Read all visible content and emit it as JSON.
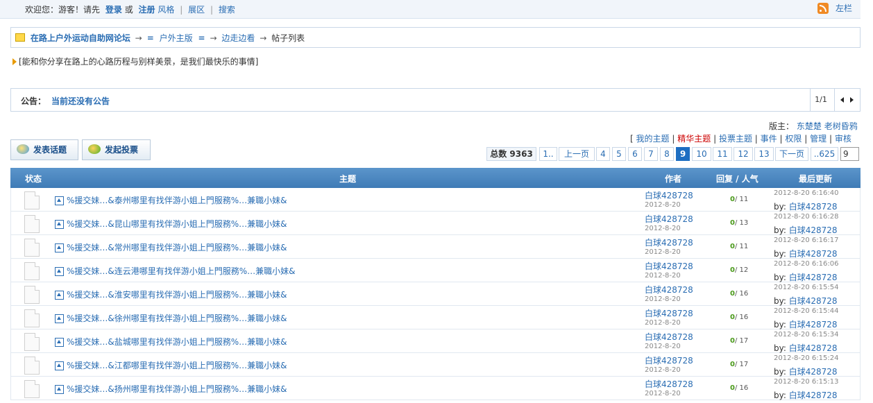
{
  "topbar": {
    "welcome": "欢迎您：游客！请先",
    "login": "登录",
    "or": "或",
    "register": "注册",
    "style": "风格",
    "exhibit": "展区",
    "search": "搜索",
    "sidebar": "左栏"
  },
  "breadcrumb": {
    "forum": "在路上户外运动自助网论坛",
    "board": "户外主版",
    "sub": "边走边看",
    "current": "帖子列表"
  },
  "tagline": "[能和你分享在路上的心路历程与别样美景，是我们最快乐的事情]",
  "notice": {
    "label": "公告：",
    "text": "当前还没有公告",
    "page": "1/1"
  },
  "moderators": {
    "label": "版主：",
    "names": [
      "东楚楚",
      "老树昏鸦"
    ]
  },
  "topic_links": [
    "我的主题",
    "精华主题",
    "投票主题",
    "事件",
    "权限",
    "管理",
    "审核"
  ],
  "buttons": {
    "new_topic": "发表话题",
    "new_poll": "发起投票"
  },
  "pager": {
    "total_label": "总数",
    "total": "9363",
    "first": "1..",
    "prev": "上一页",
    "pages": [
      "4",
      "5",
      "6",
      "7",
      "8",
      "9",
      "10",
      "11",
      "12",
      "13"
    ],
    "current": "9",
    "next": "下一页",
    "last": "..625",
    "input": "9"
  },
  "table": {
    "headers": {
      "status": "状态",
      "topic": "主题",
      "author": "作者",
      "stats": "回复 / 人气",
      "last": "最后更新"
    },
    "rows": [
      {
        "title": "%援交妹…&泰州哪里有找伴游小姐上門服務%…兼職小妹&",
        "author": "白球428728",
        "date": "2012-8-20",
        "replies": "0",
        "views": "/ 11",
        "last_time": "2012-8-20 6:16:40",
        "by": "by:",
        "last_user": "白球428728"
      },
      {
        "title": "%援交妹…&昆山哪里有找伴游小姐上門服務%…兼職小妹&",
        "author": "白球428728",
        "date": "2012-8-20",
        "replies": "0",
        "views": "/ 13",
        "last_time": "2012-8-20 6:16:28",
        "by": "by:",
        "last_user": "白球428728"
      },
      {
        "title": "%援交妹…&常州哪里有找伴游小姐上門服務%…兼職小妹&",
        "author": "白球428728",
        "date": "2012-8-20",
        "replies": "0",
        "views": "/ 11",
        "last_time": "2012-8-20 6:16:17",
        "by": "by:",
        "last_user": "白球428728"
      },
      {
        "title": "%援交妹…&连云港哪里有找伴游小姐上門服務%…兼職小妹&",
        "author": "白球428728",
        "date": "2012-8-20",
        "replies": "0",
        "views": "/ 12",
        "last_time": "2012-8-20 6:16:06",
        "by": "by:",
        "last_user": "白球428728"
      },
      {
        "title": "%援交妹…&淮安哪里有找伴游小姐上門服務%…兼職小妹&",
        "author": "白球428728",
        "date": "2012-8-20",
        "replies": "0",
        "views": "/ 16",
        "last_time": "2012-8-20 6:15:54",
        "by": "by:",
        "last_user": "白球428728"
      },
      {
        "title": "%援交妹…&徐州哪里有找伴游小姐上門服務%…兼職小妹&",
        "author": "白球428728",
        "date": "2012-8-20",
        "replies": "0",
        "views": "/ 16",
        "last_time": "2012-8-20 6:15:44",
        "by": "by:",
        "last_user": "白球428728"
      },
      {
        "title": "%援交妹…&盐城哪里有找伴游小姐上門服務%…兼職小妹&",
        "author": "白球428728",
        "date": "2012-8-20",
        "replies": "0",
        "views": "/ 17",
        "last_time": "2012-8-20 6:15:34",
        "by": "by:",
        "last_user": "白球428728"
      },
      {
        "title": "%援交妹…&江都哪里有找伴游小姐上門服務%…兼職小妹&",
        "author": "白球428728",
        "date": "2012-8-20",
        "replies": "0",
        "views": "/ 17",
        "last_time": "2012-8-20 6:15:24",
        "by": "by:",
        "last_user": "白球428728"
      },
      {
        "title": "%援交妹…&扬州哪里有找伴游小姐上門服務%…兼職小妹&",
        "author": "白球428728",
        "date": "2012-8-20",
        "replies": "0",
        "views": "/ 16",
        "last_time": "2012-8-20 6:15:13",
        "by": "by:",
        "last_user": "白球428728"
      }
    ]
  },
  "colors": {
    "link": "#2a6db3",
    "header_bg": "#4a86c0",
    "current_page": "#1d6ec2",
    "digest": "#cc0000"
  }
}
